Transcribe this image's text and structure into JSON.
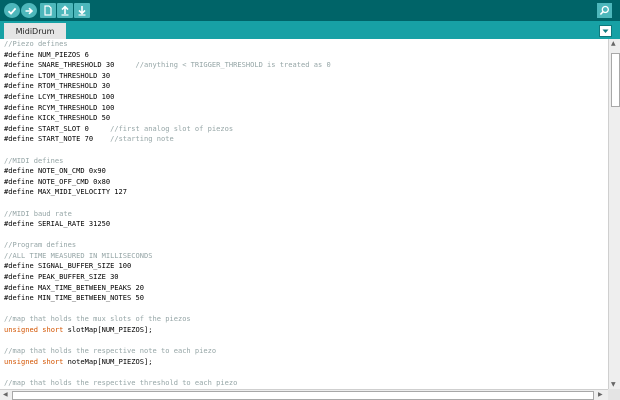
{
  "toolbar": {
    "buttons": [
      {
        "name": "verify-button",
        "icon": "checkmark-icon"
      },
      {
        "name": "upload-button",
        "icon": "arrow-right-icon"
      },
      {
        "name": "new-button",
        "icon": "new-file-icon"
      },
      {
        "name": "open-button",
        "icon": "arrow-up-icon"
      },
      {
        "name": "save-button",
        "icon": "arrow-down-icon"
      }
    ],
    "serial_monitor_icon": "magnifier-icon"
  },
  "tabs": [
    {
      "label": "MidiDrum"
    }
  ],
  "tab_menu_icon": "chevron-down-icon",
  "colors": {
    "toolbar_bg": "#006468",
    "tabbar_bg": "#17a1a5",
    "button_bg": "#4db7bb",
    "comment": "#95a5a6",
    "keyword": "#d35400"
  },
  "code_lines": [
    [
      {
        "t": "//Piezo defines",
        "c": "cmt"
      }
    ],
    [
      {
        "t": "#define NUM_PIEZOS 6"
      }
    ],
    [
      {
        "t": "#define SNARE_THRESHOLD 30     "
      },
      {
        "t": "//anything < TRIGGER_THRESHOLD is treated as 0",
        "c": "cmt"
      }
    ],
    [
      {
        "t": "#define LTOM_THRESHOLD 30"
      }
    ],
    [
      {
        "t": "#define RTOM_THRESHOLD 30"
      }
    ],
    [
      {
        "t": "#define LCYM_THRESHOLD 100"
      }
    ],
    [
      {
        "t": "#define RCYM_THRESHOLD 100"
      }
    ],
    [
      {
        "t": "#define KICK_THRESHOLD 50"
      }
    ],
    [
      {
        "t": "#define START_SLOT 0     "
      },
      {
        "t": "//first analog slot of piezos",
        "c": "cmt"
      }
    ],
    [
      {
        "t": "#define START_NOTE 70    "
      },
      {
        "t": "//starting note",
        "c": "cmt"
      }
    ],
    [],
    [
      {
        "t": "//MIDI defines",
        "c": "cmt"
      }
    ],
    [
      {
        "t": "#define NOTE_ON_CMD 0x90"
      }
    ],
    [
      {
        "t": "#define NOTE_OFF_CMD 0x80"
      }
    ],
    [
      {
        "t": "#define MAX_MIDI_VELOCITY 127"
      }
    ],
    [],
    [
      {
        "t": "//MIDI baud rate",
        "c": "cmt"
      }
    ],
    [
      {
        "t": "#define SERIAL_RATE 31250"
      }
    ],
    [],
    [
      {
        "t": "//Program defines",
        "c": "cmt"
      }
    ],
    [
      {
        "t": "//ALL TIME MEASURED IN MILLISECONDS",
        "c": "cmt"
      }
    ],
    [
      {
        "t": "#define SIGNAL_BUFFER_SIZE 100"
      }
    ],
    [
      {
        "t": "#define PEAK_BUFFER_SIZE 30"
      }
    ],
    [
      {
        "t": "#define MAX_TIME_BETWEEN_PEAKS 20"
      }
    ],
    [
      {
        "t": "#define MIN_TIME_BETWEEN_NOTES 50"
      }
    ],
    [],
    [
      {
        "t": "//map that holds the mux slots of the piezos",
        "c": "cmt"
      }
    ],
    [
      {
        "t": "unsigned",
        "c": "kw"
      },
      {
        "t": " "
      },
      {
        "t": "short",
        "c": "kw"
      },
      {
        "t": " slotMap[NUM_PIEZOS];"
      }
    ],
    [],
    [
      {
        "t": "//map that holds the respective note to each piezo",
        "c": "cmt"
      }
    ],
    [
      {
        "t": "unsigned",
        "c": "kw"
      },
      {
        "t": " "
      },
      {
        "t": "short",
        "c": "kw"
      },
      {
        "t": " noteMap[NUM_PIEZOS];"
      }
    ],
    [],
    [
      {
        "t": "//map that holds the respective threshold to each piezo",
        "c": "cmt"
      }
    ]
  ]
}
